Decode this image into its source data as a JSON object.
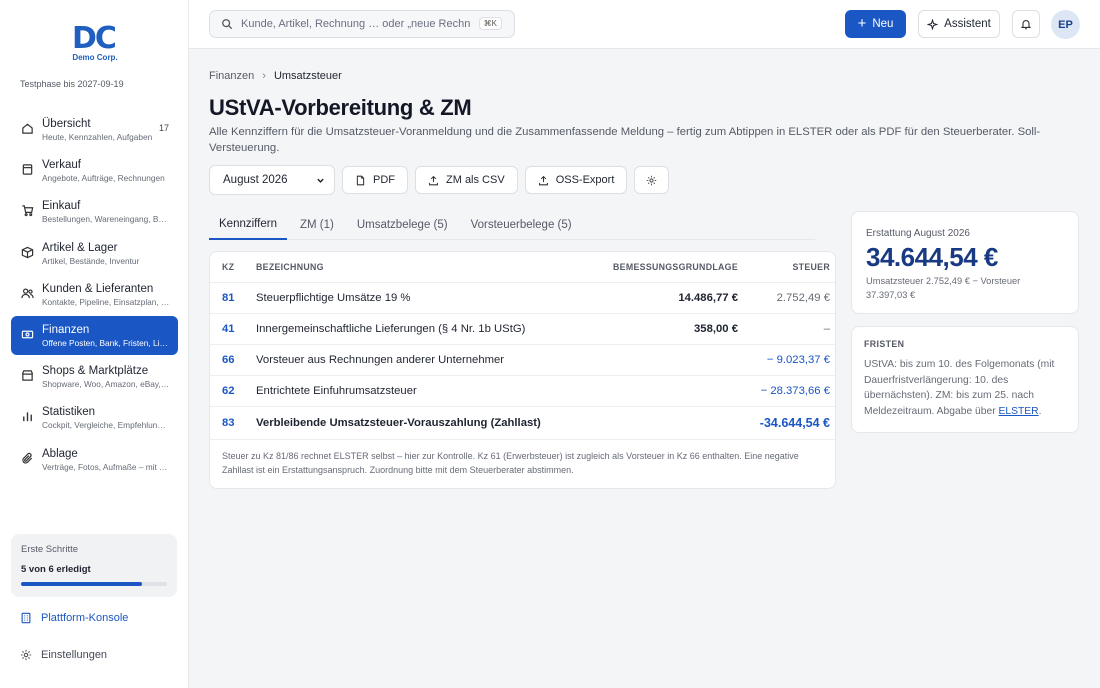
{
  "brand": {
    "letters": "DC",
    "name": "Demo Corp.",
    "trial": "Testphase bis 2027-09-19"
  },
  "sidebar": {
    "items": [
      {
        "label": "Übersicht",
        "sub": "Heute, Kennzahlen, Aufgaben",
        "badge": "17",
        "icon": "home-icon"
      },
      {
        "label": "Verkauf",
        "sub": "Angebote, Aufträge, Rechnungen",
        "icon": "receipt-icon"
      },
      {
        "label": "Einkauf",
        "sub": "Bestellungen, Wareneingang, Belege",
        "icon": "cart-icon"
      },
      {
        "label": "Artikel & Lager",
        "sub": "Artikel, Bestände, Inventur",
        "icon": "box-icon"
      },
      {
        "label": "Kunden & Lieferanten",
        "sub": "Kontakte, Pipeline, Einsatzplan, Lieferanten",
        "icon": "users-icon"
      },
      {
        "label": "Finanzen",
        "sub": "Offene Posten, Bank, Fristen, Liquidität",
        "icon": "money-icon"
      },
      {
        "label": "Shops & Marktplätze",
        "sub": "Shopware, Woo, Amazon, eBay, Etsy",
        "icon": "shop-icon"
      },
      {
        "label": "Statistiken",
        "sub": "Cockpit, Vergleiche, Empfehlungen",
        "icon": "chart-icon"
      },
      {
        "label": "Ablage",
        "sub": "Verträge, Fotos, Aufmaße – mit Tags",
        "icon": "paperclip-icon"
      }
    ],
    "onboarding": {
      "title": "Erste Schritte",
      "status": "5 von 6 erledigt",
      "progress": 0.83
    },
    "platform": "Plattform-Konsole",
    "settings": "Einstellungen"
  },
  "topbar": {
    "search_placeholder": "Kunde, Artikel, Rechnung … oder „neue Rechnung“",
    "shortcut": "⌘K",
    "new_label": "Neu",
    "assistant_label": "Assistent",
    "avatar": "EP"
  },
  "breadcrumb": {
    "parent": "Finanzen",
    "current": "Umsatzsteuer"
  },
  "page": {
    "title": "UStVA-Vorbereitung & ZM",
    "description": "Alle Kennziffern für die Umsatzsteuer-Voranmeldung und die Zusammenfassende Meldung – fertig zum Abtippen in ELSTER oder als PDF für den Steuerberater. Soll-Versteuerung."
  },
  "actions": {
    "period": "August 2026",
    "pdf": "PDF",
    "zm_csv": "ZM als CSV",
    "oss": "OSS-Export"
  },
  "tabs": [
    {
      "label": "Kennziffern",
      "active": true
    },
    {
      "label": "ZM (1)",
      "active": false
    },
    {
      "label": "Umsatzbelege (5)",
      "active": false
    },
    {
      "label": "Vorsteuerbelege (5)",
      "active": false
    }
  ],
  "table": {
    "headers": {
      "kz": "KZ",
      "bezeichnung": "BEZEICHNUNG",
      "bemessung": "BEMESSUNGSGRUNDLAGE",
      "steuer": "STEUER"
    },
    "rows": [
      {
        "kz": "81",
        "bezeichnung": "Steuerpflichtige Umsätze 19 %",
        "bemessung": "14.486,77 €",
        "steuer": "2.752,49 €"
      },
      {
        "kz": "41",
        "bezeichnung": "Innergemeinschaftliche Lieferungen (§ 4 Nr. 1b UStG)",
        "bemessung": "358,00 €",
        "steuer": "–"
      },
      {
        "kz": "66",
        "bezeichnung": "Vorsteuer aus Rechnungen anderer Unternehmer",
        "bemessung": "",
        "steuer": "− 9.023,37 €"
      },
      {
        "kz": "62",
        "bezeichnung": "Entrichtete Einfuhrumsatzsteuer",
        "bemessung": "",
        "steuer": "− 28.373,66 €"
      },
      {
        "kz": "83",
        "bezeichnung": "Verbleibende Umsatzsteuer-Vorauszahlung (Zahllast)",
        "bemessung": "",
        "steuer": "-34.644,54 €"
      }
    ],
    "note": "Steuer zu Kz 81/86 rechnet ELSTER selbst – hier zur Kontrolle. Kz 61 (Erwerbsteuer) ist zugleich als Vorsteuer in Kz 66 enthalten. Eine negative Zahllast ist ein Erstattungsanspruch. Zuordnung bitte mit dem Steuerberater abstimmen."
  },
  "refund": {
    "label": "Erstattung August 2026",
    "value": "34.644,54 €",
    "detail": "Umsatzsteuer 2.752,49 € − Vorsteuer 37.397,03 €"
  },
  "deadlines": {
    "heading": "FRISTEN",
    "text": "UStVA: bis zum 10. des Folgemonats (mit Dauerfristverlängerung: 10. des übernächsten). ZM: bis zum 25. nach Meldezeitraum. Abgabe über",
    "link": "ELSTER",
    "end": "."
  },
  "colors": {
    "accent": "#1a56c4",
    "refund_value": "#173a82",
    "background": "#f4f5f7"
  }
}
